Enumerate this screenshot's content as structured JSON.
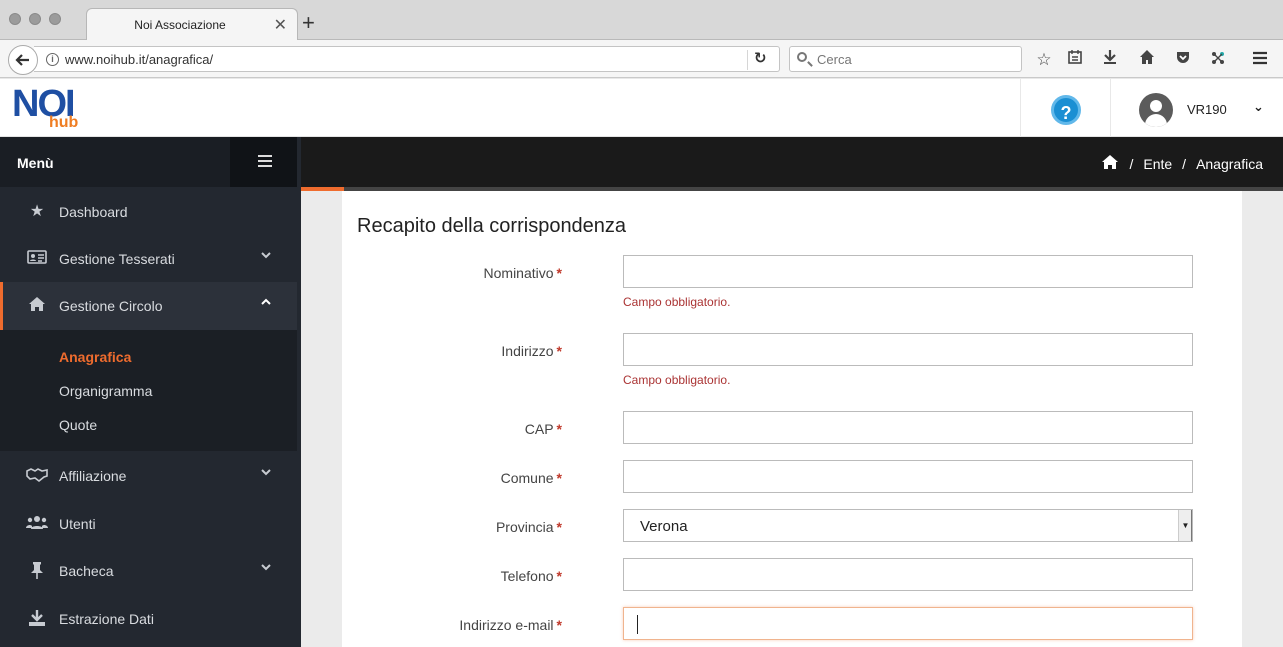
{
  "browser": {
    "tab_title": "Noi Associazione",
    "tab_close": "✕",
    "new_tab": "+",
    "url": "www.noihub.it/anagrafica/",
    "search_placeholder": "Cerca"
  },
  "header": {
    "logo_primary": "NOI",
    "logo_secondary": "hub",
    "help_symbol": "?",
    "username": "VR190"
  },
  "sidebar": {
    "title": "Menù",
    "items": [
      {
        "label": "Dashboard",
        "icon": "star-icon"
      },
      {
        "label": "Gestione Tesserati",
        "icon": "id-card-icon"
      },
      {
        "label": "Gestione Circolo",
        "icon": "home-icon"
      },
      {
        "label": "Affiliazione",
        "icon": "handshake-icon"
      },
      {
        "label": "Utenti",
        "icon": "users-icon"
      },
      {
        "label": "Bacheca",
        "icon": "pin-icon"
      },
      {
        "label": "Estrazione Dati",
        "icon": "download-icon"
      }
    ],
    "subitems": [
      {
        "label": "Anagrafica"
      },
      {
        "label": "Organigramma"
      },
      {
        "label": "Quote"
      }
    ]
  },
  "breadcrumb": {
    "items": [
      "Ente",
      "Anagrafica"
    ]
  },
  "form": {
    "title": "Recapito della corrispondenza",
    "required_mark": "*",
    "error_text": "Campo obbligatorio.",
    "fields": [
      {
        "label": "Nominativo",
        "value": ""
      },
      {
        "label": "Indirizzo",
        "value": ""
      },
      {
        "label": "CAP",
        "value": ""
      },
      {
        "label": "Comune",
        "value": ""
      },
      {
        "label": "Provincia",
        "value": "Verona"
      },
      {
        "label": "Telefono",
        "value": ""
      },
      {
        "label": "Indirizzo e-mail",
        "value": ""
      }
    ]
  },
  "colors": {
    "accent": "#ef6c2e",
    "brand_blue": "#1f4fa3",
    "sidebar_bg": "#232830",
    "help_blue": "#1b8fd3"
  }
}
